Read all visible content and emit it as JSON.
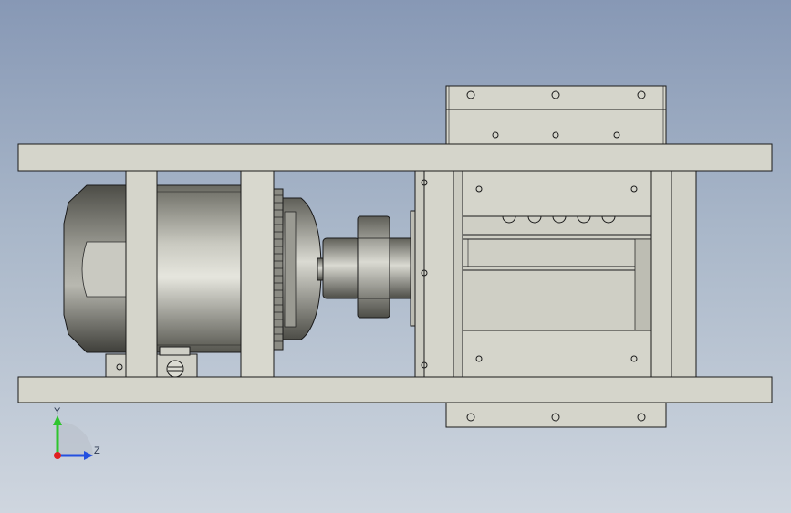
{
  "viewport": {
    "background_top": "#8798b5",
    "background_bottom": "#cfd6df"
  },
  "model": {
    "part_fill": "#d5d5cb",
    "edge_color": "#1a1a1a",
    "shaded_metal": "#a7a79f"
  },
  "triad": {
    "y_label": "Y",
    "z_label": "Z",
    "y_color": "#2ec52e",
    "z_color": "#2450e0",
    "x_color": "#e02020"
  }
}
